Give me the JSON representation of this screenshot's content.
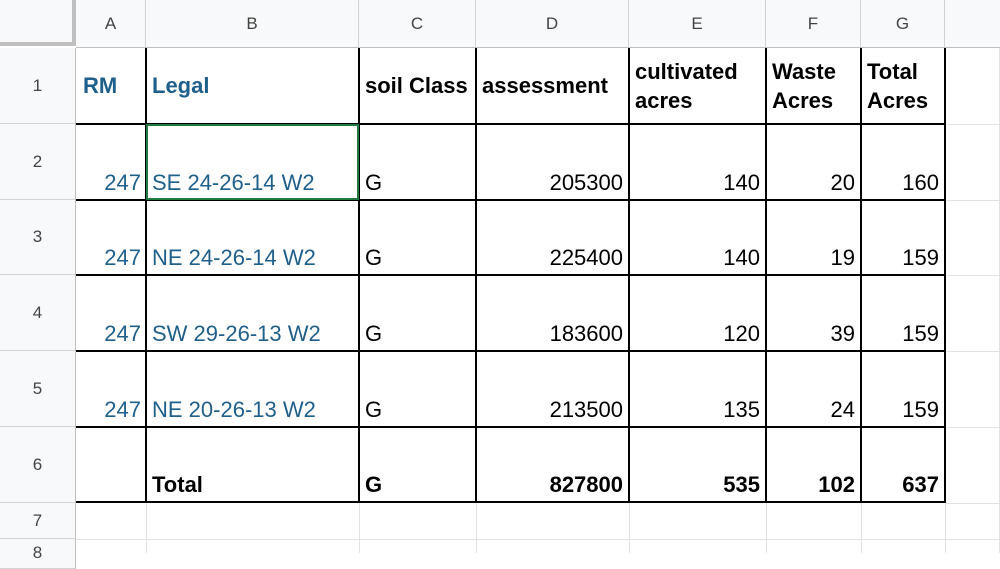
{
  "columns": [
    "A",
    "B",
    "C",
    "D",
    "E",
    "F",
    "G"
  ],
  "rows": [
    "1",
    "2",
    "3",
    "4",
    "5",
    "6",
    "7",
    "8"
  ],
  "header": {
    "rm": "RM",
    "legal": "Legal",
    "soil_class": "soil Class",
    "assessment": "assessment",
    "cultivated": "cultivated acres",
    "waste": "Waste Acres",
    "total_acres": "Total Acres"
  },
  "data_rows": [
    {
      "rm": "247",
      "legal": "SE 24-26-14 W2",
      "soil": "G",
      "assessment": "205300",
      "cultivated": "140",
      "waste": "20",
      "total": "160"
    },
    {
      "rm": "247",
      "legal": "NE 24-26-14 W2",
      "soil": "G",
      "assessment": "225400",
      "cultivated": "140",
      "waste": "19",
      "total": "159"
    },
    {
      "rm": "247",
      "legal": "SW 29-26-13 W2",
      "soil": "G",
      "assessment": "183600",
      "cultivated": "120",
      "waste": "39",
      "total": "159"
    },
    {
      "rm": "247",
      "legal": "NE 20-26-13 W2",
      "soil": "G",
      "assessment": "213500",
      "cultivated": "135",
      "waste": "24",
      "total": "159"
    }
  ],
  "total_row": {
    "label": "Total",
    "soil": "G",
    "assessment": "827800",
    "cultivated": "535",
    "waste": "102",
    "total": "637"
  },
  "colors": {
    "header_text": "#1f5f8b",
    "selection_border": "#1e7a3f",
    "gridline": "#000000"
  }
}
